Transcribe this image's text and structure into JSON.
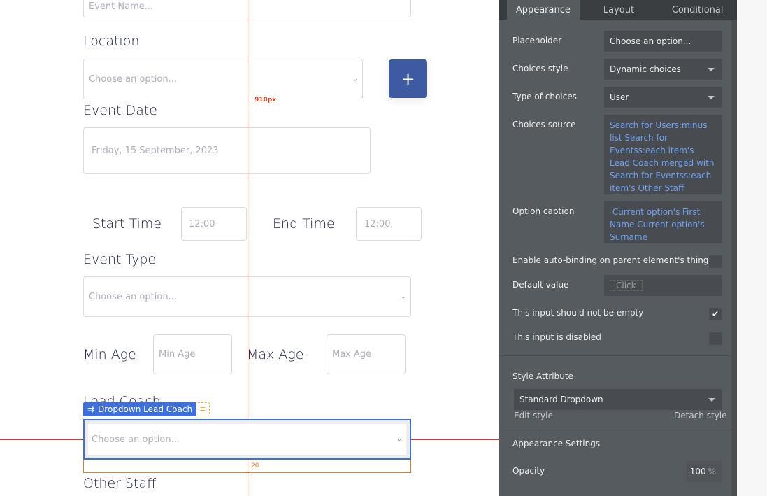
{
  "canvas": {
    "event_name_placeholder": "Event Name...",
    "location_label": "Location",
    "location_placeholder": "Choose an option...",
    "add_button": "+",
    "ruler_label": "910px",
    "event_date_label": "Event Date",
    "event_date_value": "Friday, 15 September, 2023",
    "start_time_label": "Start Time",
    "start_time_value": "12:00",
    "end_time_label": "End Time",
    "end_time_value": "12:00",
    "event_type_label": "Event Type",
    "event_type_placeholder": "Choose an option...",
    "min_age_label": "Min Age",
    "min_age_placeholder": "Min Age",
    "max_age_label": "Max Age",
    "max_age_placeholder": "Max Age",
    "lead_coach_label": "Lead Coach",
    "selected_element_tag": "Dropdown Lead Coach",
    "lead_coach_placeholder": "Choose an option...",
    "margin_label": "20",
    "other_staff_label": "Other Staff"
  },
  "panel": {
    "tabs": [
      "Appearance",
      "Layout",
      "Conditional"
    ],
    "placeholder_label": "Placeholder",
    "placeholder_value": "Choose an option...",
    "choices_style_label": "Choices style",
    "choices_style_value": "Dynamic choices",
    "type_label": "Type of choices",
    "type_value": "User",
    "source_label": "Choices source",
    "source_value": "Search for Users:minus list Search for Eventss:each item's Lead Coach merged with Search for Eventss:each item's Other Staff",
    "caption_label": "Option caption",
    "caption_value": " Current option's First Name Current option's Surname",
    "autobind_label": "Enable auto-binding on parent element's thing",
    "default_label": "Default value",
    "default_value": "Click",
    "not_empty_label": "This input should not be empty",
    "not_empty_checked": true,
    "disabled_label": "This input is disabled",
    "disabled_checked": false,
    "style_attr_label": "Style Attribute",
    "style_value": "Standard Dropdown",
    "edit_style": "Edit style",
    "detach_style": "Detach style",
    "appearance_settings": "Appearance Settings",
    "opacity_label": "Opacity",
    "opacity_value": "100",
    "opacity_unit": "%"
  },
  "colors": {
    "accent": "#3e5ba1",
    "selection": "#3f6fd8",
    "guide": "#e53a1e",
    "margin": "#e07b22",
    "link": "#6fa0f0"
  }
}
